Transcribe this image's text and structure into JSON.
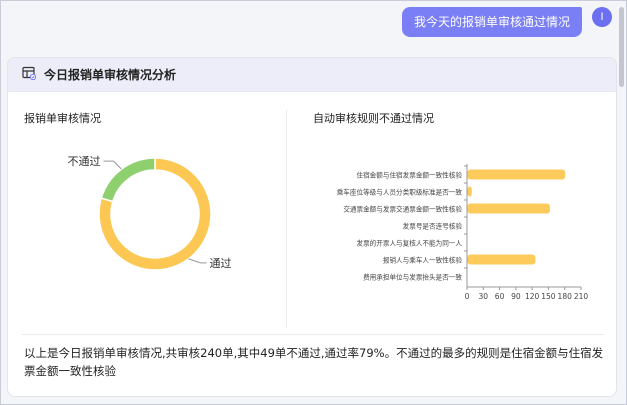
{
  "user_message": "我今天的报销单审核通过情况",
  "user_avatar_letter": "I",
  "card": {
    "title": "今日报销单审核情况分析"
  },
  "left_panel": {
    "title": "报销单审核情况"
  },
  "right_panel": {
    "title": "自动审核规则不通过情况"
  },
  "summary": "以上是今日报销单审核情况,共审核240单,其中49单不通过,通过率79%。不通过的最多的规则是住宿金额与住宿发票金额一致性核验",
  "colors": {
    "accent": "#7b7ff5",
    "pass": "#fcc853",
    "fail": "#8fd06e",
    "bar": "#fdcb5b"
  },
  "chart_data": [
    {
      "type": "pie",
      "title": "报销单审核情况",
      "slices": [
        {
          "label": "通过",
          "value": 191
        },
        {
          "label": "不通过",
          "value": 49
        }
      ]
    },
    {
      "type": "bar",
      "orientation": "horizontal",
      "title": "自动审核规则不通过情况",
      "categories": [
        "住宿金额与住宿发票金额一致性核验",
        "乘车座位等级与人员分类职级标准是否一致",
        "交通票金额与发票交通票金额一致性核验",
        "发票号是否连号核验",
        "发票的开票人与复核人不能为同一人",
        "报销人与乘车人一致性核验",
        "费用承担单位与发票抬头是否一致"
      ],
      "values": [
        180,
        8,
        152,
        0,
        0,
        125,
        0
      ],
      "xticks": [
        "0",
        "30",
        "60",
        "90",
        "120",
        "150",
        "180",
        "210"
      ],
      "xlim": [
        0,
        210
      ]
    }
  ]
}
